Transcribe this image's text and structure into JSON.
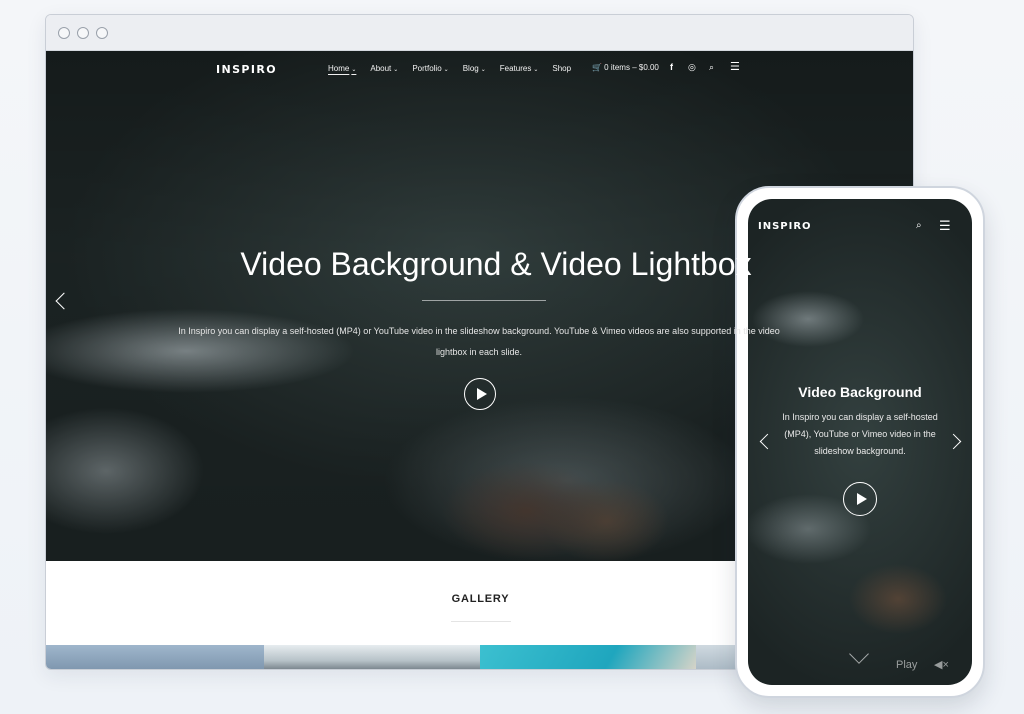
{
  "desktop": {
    "logo": "INSPIRO",
    "menu": [
      {
        "label": "Home",
        "caret": "⌄"
      },
      {
        "label": "About",
        "caret": "⌄"
      },
      {
        "label": "Portfolio",
        "caret": "⌄"
      },
      {
        "label": "Blog",
        "caret": "⌄"
      },
      {
        "label": "Features",
        "caret": "⌄"
      },
      {
        "label": "Shop",
        "caret": ""
      }
    ],
    "cart": "🛒 0 items – $0.00",
    "hero": {
      "title": "Video Background & Video Lightbox",
      "description": "In Inspiro you can display a self-hosted (MP4) or YouTube video in the slideshow background. YouTube & Vimeo videos are also supported in the video lightbox in each slide."
    },
    "gallery_title": "GALLERY"
  },
  "mobile": {
    "logo": "INSPIRO",
    "title": "Video Background",
    "description": "In Inspiro you can display a self-hosted (MP4), YouTube or Vimeo video in the slideshow background.",
    "play_label": "Play"
  },
  "icons": {
    "facebook": "f",
    "instagram": "◎",
    "search": "⌕",
    "menu": "☰",
    "mute": "◀×"
  }
}
